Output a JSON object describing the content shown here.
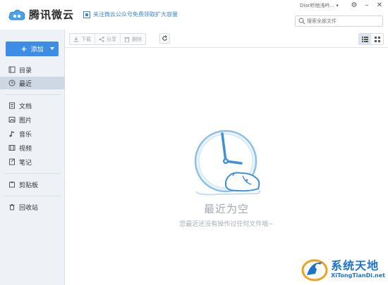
{
  "app": {
    "name": "腾讯微云",
    "promo_text": "关注微云公众号免费领取扩大容量",
    "user_name": "Dior听他浅吟...",
    "window_controls": [
      "gear-icon",
      "minimize-icon",
      "close-icon"
    ]
  },
  "search": {
    "placeholder": "搜索全部文件"
  },
  "sidebar": {
    "add_label": "添加",
    "items": [
      {
        "label": "目录",
        "icon": "directory-icon"
      },
      {
        "label": "最近",
        "icon": "clock-icon",
        "active": true
      },
      {
        "label": "文档",
        "icon": "document-icon"
      },
      {
        "label": "图片",
        "icon": "image-icon"
      },
      {
        "label": "音乐",
        "icon": "music-icon"
      },
      {
        "label": "视频",
        "icon": "video-icon"
      },
      {
        "label": "笔记",
        "icon": "note-icon"
      },
      {
        "label": "剪贴板",
        "icon": "clipboard-icon"
      },
      {
        "label": "回收站",
        "icon": "trash-icon"
      }
    ]
  },
  "toolbar": {
    "download_label": "下载",
    "share_label": "分享",
    "delete_label": "删除"
  },
  "empty_state": {
    "title": "最近为空",
    "subtitle": "您最近还没有操作过任何文件哦~"
  },
  "watermark": {
    "cn": "系统天地",
    "en": "XiTongTianDi.net"
  },
  "colors": {
    "accent": "#3d8ce6",
    "sidebar_bg": "#eef2f7",
    "active_bg": "#cdd8e4",
    "empty_text": "#a0a9b4"
  }
}
